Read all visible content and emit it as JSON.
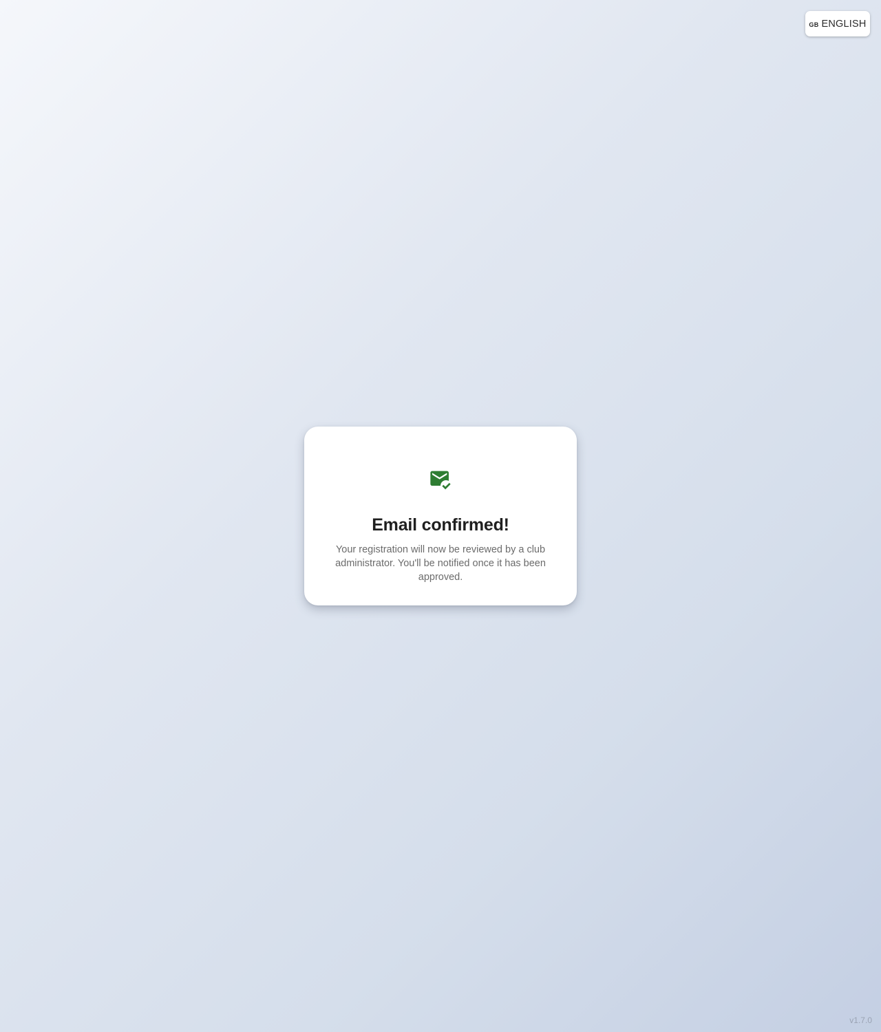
{
  "language_selector": {
    "flag": "GB",
    "label": "ENGLISH",
    "icon": "gb-flag-icon"
  },
  "confirmation": {
    "icon": "mark-email-read-icon",
    "icon_color": "#2e7d32",
    "title": "Email confirmed!",
    "message": "Your registration will now be reviewed by a club administrator. You'll be notified once it has been approved."
  },
  "footer": {
    "version": "v1.7.0"
  }
}
